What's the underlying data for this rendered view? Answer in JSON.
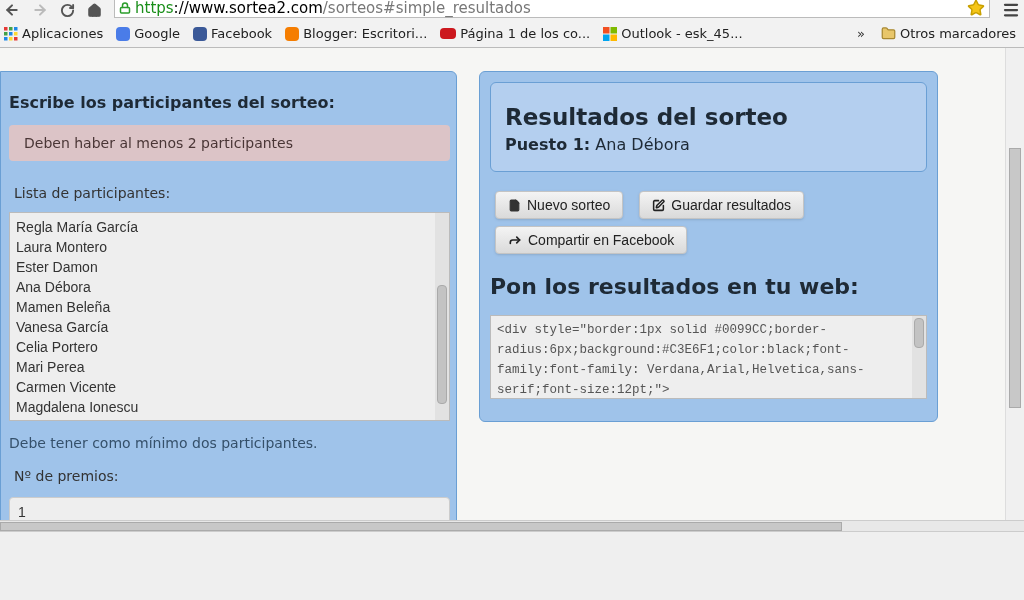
{
  "browser": {
    "url": {
      "scheme": "https",
      "host": "://www.sortea2.com",
      "path": "/sorteos#simple_resultados"
    },
    "bookmarks": [
      {
        "kind": "apps",
        "label": "Aplicaciones"
      },
      {
        "kind": "google",
        "label": "Google"
      },
      {
        "kind": "facebook",
        "label": "Facebook"
      },
      {
        "kind": "blogger",
        "label": "Blogger: Escritori..."
      },
      {
        "kind": "youtube",
        "label": "Página 1 de los co..."
      },
      {
        "kind": "outlook",
        "label": "Outlook - esk_45..."
      }
    ],
    "overflow": "»",
    "other_bookmarks": "Otros marcadores"
  },
  "participants_panel": {
    "heading": "Escribe los participantes del sorteo:",
    "alert": "Deben haber al menos 2 participantes",
    "list_label": "Lista de participantes:",
    "participants": [
      "Regla María García",
      "Laura Montero",
      "Ester Damon",
      "Ana Débora",
      "Mamen Beleña",
      "Vanesa García",
      "Celia Portero",
      "Mari Perea",
      "Carmen Vicente",
      "Magdalena Ionescu"
    ],
    "hint": "Debe tener como mínimo dos participantes.",
    "prizes_label": "Nº de premios:",
    "prizes_value": "1"
  },
  "results_panel": {
    "title": "Resultados del sorteo",
    "place_label": "Puesto 1:",
    "place_winner": "Ana Débora",
    "buttons": [
      {
        "kind": "new",
        "label": "Nuevo sorteo"
      },
      {
        "kind": "save",
        "label": "Guardar resultados"
      },
      {
        "kind": "share",
        "label": "Compartir en Facebook"
      }
    ],
    "embed_heading": "Pon los resultados en tu web:",
    "embed_code": [
      "<div style=\"border:1px solid #0099CC;border-",
      "radius:6px;background:#C3E6F1;color:black;font-",
      "family:font-family: Verdana,Arial,Helvetica,sans-",
      "serif;font-size:12pt;\">"
    ]
  }
}
